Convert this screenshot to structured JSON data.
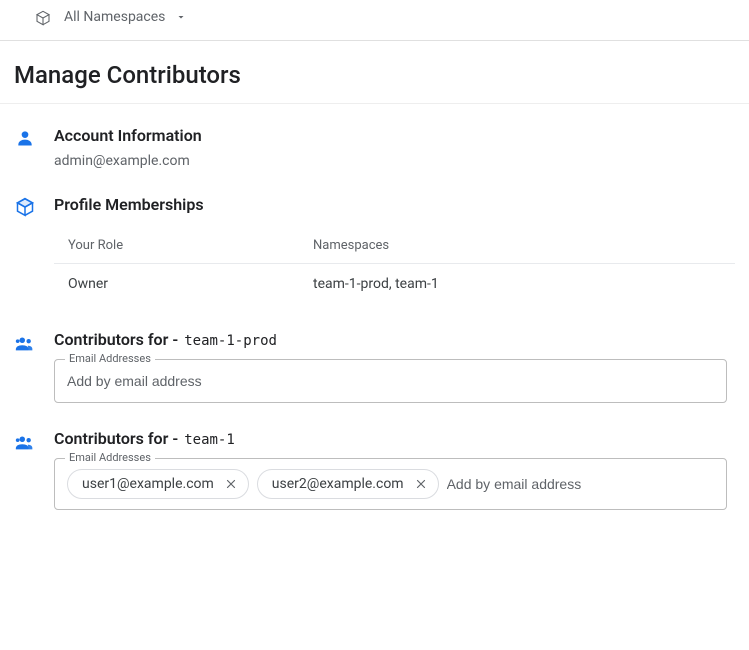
{
  "topbar": {
    "namespace_label": "All Namespaces"
  },
  "page": {
    "title": "Manage Contributors"
  },
  "account": {
    "heading": "Account Information",
    "email": "admin@example.com"
  },
  "memberships": {
    "heading": "Profile Memberships",
    "col_role": "Your Role",
    "col_ns": "Namespaces",
    "rows": [
      {
        "role": "Owner",
        "namespaces": "team-1-prod, team-1"
      }
    ]
  },
  "contributors": [
    {
      "prefix": "Contributors for -",
      "namespace": "team-1-prod",
      "field_label": "Email Addresses",
      "placeholder": "Add by email address",
      "chips": []
    },
    {
      "prefix": "Contributors for -",
      "namespace": "team-1",
      "field_label": "Email Addresses",
      "placeholder": "Add by email address",
      "chips": [
        "user1@example.com",
        "user2@example.com"
      ]
    }
  ],
  "colors": {
    "accent_blue": "#1a73e8",
    "muted": "#5f6368"
  }
}
